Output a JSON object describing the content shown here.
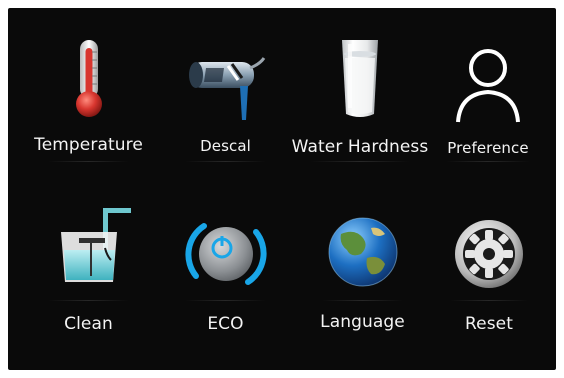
{
  "menu": {
    "items": [
      {
        "label": "Temperature",
        "icon": "thermometer-icon"
      },
      {
        "label": "Descal",
        "icon": "descale-icon"
      },
      {
        "label": "Water Hardness",
        "icon": "water-glass-icon"
      },
      {
        "label": "Preference",
        "icon": "user-profile-icon"
      },
      {
        "label": "Clean",
        "icon": "clean-icon"
      },
      {
        "label": "ECO",
        "icon": "power-eco-icon"
      },
      {
        "label": "Language",
        "icon": "globe-icon"
      },
      {
        "label": "Reset",
        "icon": "gear-reset-icon"
      }
    ]
  },
  "colors": {
    "background": "#0a0a0a",
    "accent_blue": "#19a6e8",
    "thermometer_red": "#d8362f"
  }
}
